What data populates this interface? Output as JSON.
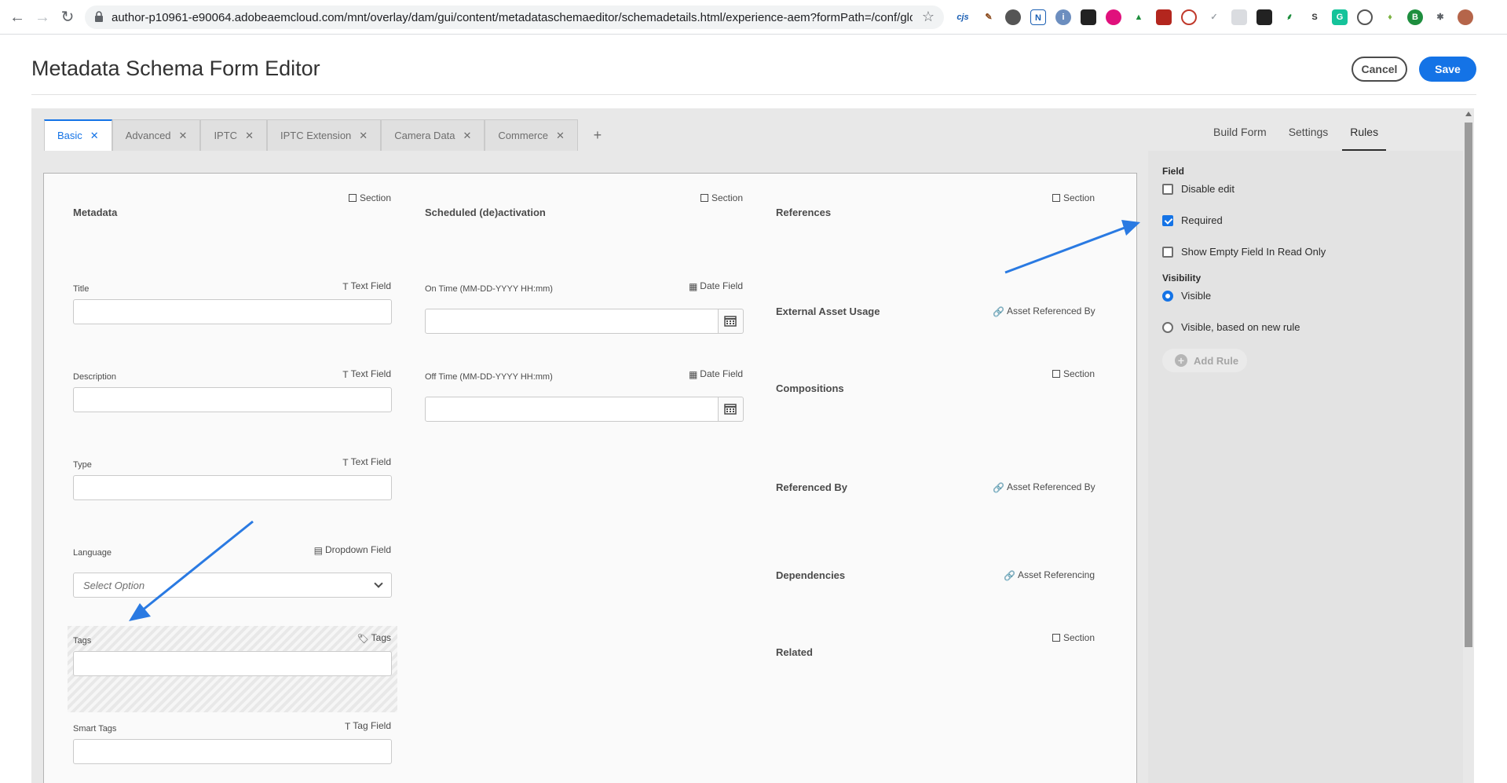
{
  "browser": {
    "url": "author-p10961-e90064.adobeaemcloud.com/mnt/overlay/dam/gui/content/metadataschemaeditor/schemadetails.html/experience-aem?formPath=/conf/global/se..."
  },
  "header": {
    "title": "Metadata Schema Form Editor",
    "cancel_label": "Cancel",
    "save_label": "Save"
  },
  "tabs": [
    {
      "label": "Basic"
    },
    {
      "label": "Advanced"
    },
    {
      "label": "IPTC"
    },
    {
      "label": "IPTC Extension"
    },
    {
      "label": "Camera Data"
    },
    {
      "label": "Commerce"
    }
  ],
  "tab_add": "+",
  "right_tabs": [
    {
      "label": "Build Form"
    },
    {
      "label": "Settings"
    },
    {
      "label": "Rules"
    }
  ],
  "side_panel": {
    "field_heading": "Field",
    "disable_edit": "Disable edit",
    "required": "Required",
    "show_empty": "Show Empty Field In Read Only",
    "visibility_heading": "Visibility",
    "visible": "Visible",
    "visible_rule": "Visible, based on new rule",
    "add_rule": "Add Rule"
  },
  "columns": {
    "col1": {
      "section_type": "Section",
      "section_title": "Metadata",
      "fields": [
        {
          "label": "Title",
          "type": "Text Field"
        },
        {
          "label": "Description",
          "type": "Text Field"
        },
        {
          "label": "Type",
          "type": "Text Field"
        },
        {
          "label": "Language",
          "type": "Dropdown Field",
          "placeholder": "Select Option"
        },
        {
          "label": "Tags",
          "type": "Tags"
        },
        {
          "label": "Smart Tags",
          "type": "Tag Field"
        }
      ]
    },
    "col2": {
      "section_type": "Section",
      "section_title": "Scheduled (de)activation",
      "fields": [
        {
          "label": "On Time (MM-DD-YYYY HH:mm)",
          "type": "Date Field"
        },
        {
          "label": "Off Time (MM-DD-YYYY HH:mm)",
          "type": "Date Field"
        }
      ]
    },
    "col3": {
      "items": [
        {
          "title": "References",
          "type": "Section"
        },
        {
          "title": "External Asset Usage",
          "type": "Asset Referenced By"
        },
        {
          "title": "Compositions",
          "type": "Section"
        },
        {
          "title": "Referenced By",
          "type": "Asset Referenced By"
        },
        {
          "title": "Dependencies",
          "type": "Asset Referencing"
        },
        {
          "title": "Related",
          "type": "Section"
        }
      ]
    }
  },
  "colors": {
    "accent": "#1473e6",
    "annotation_arrow": "#2a7ae2"
  }
}
